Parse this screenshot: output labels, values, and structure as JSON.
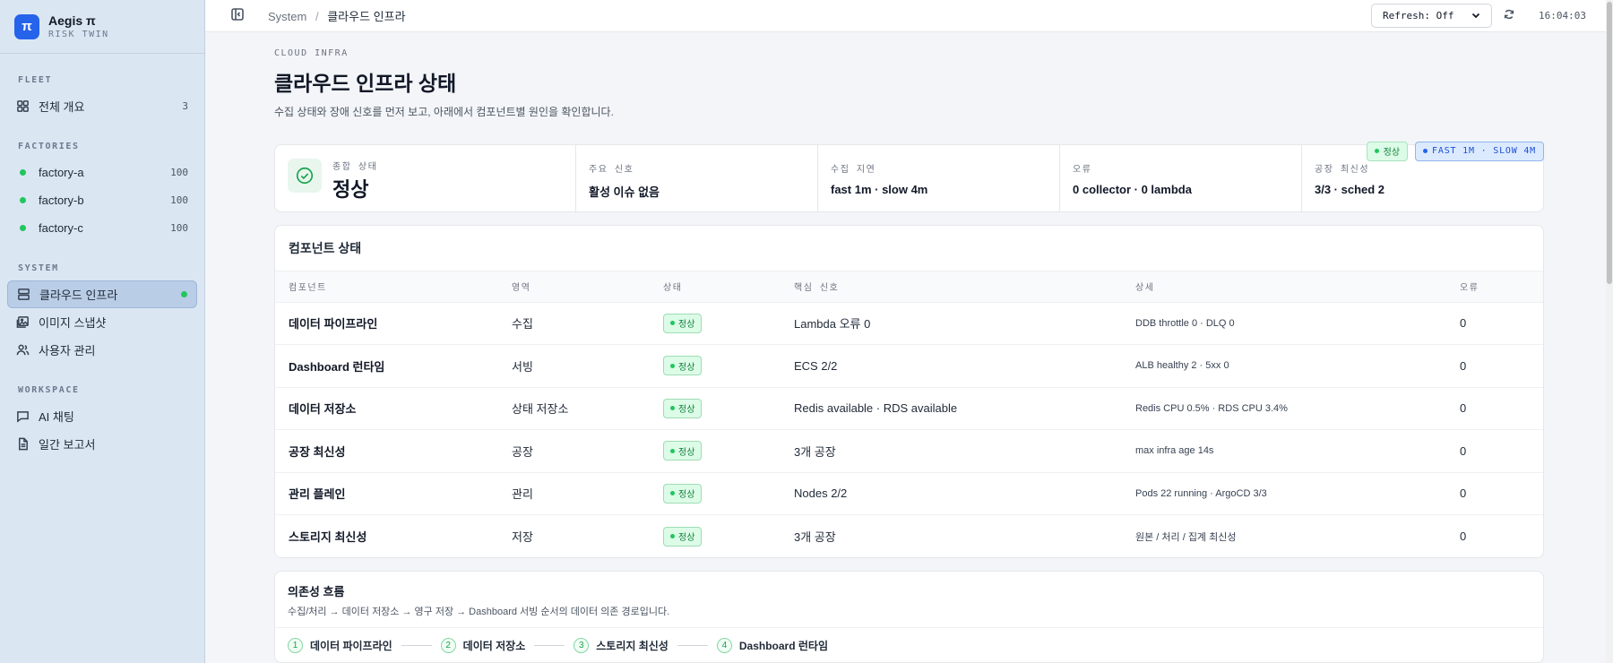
{
  "brand": {
    "logo": "π",
    "name": "Aegis π",
    "subtitle": "RISK TWIN"
  },
  "sidebar": {
    "sections": [
      {
        "heading": "FLEET",
        "items": [
          {
            "label": "전체 개요",
            "count": "3",
            "icon": "grid-icon"
          }
        ]
      },
      {
        "heading": "FACTORIES",
        "items": [
          {
            "label": "factory-a",
            "count": "100",
            "icon": "status-dot"
          },
          {
            "label": "factory-b",
            "count": "100",
            "icon": "status-dot"
          },
          {
            "label": "factory-c",
            "count": "100",
            "icon": "status-dot"
          }
        ]
      },
      {
        "heading": "SYSTEM",
        "items": [
          {
            "label": "클라우드 인프라",
            "icon": "server-icon",
            "active": true
          },
          {
            "label": "이미지 스냅샷",
            "icon": "image-icon"
          },
          {
            "label": "사용자 관리",
            "icon": "users-icon"
          }
        ]
      },
      {
        "heading": "WORKSPACE",
        "items": [
          {
            "label": "AI 채팅",
            "icon": "chat-icon"
          },
          {
            "label": "일간 보고서",
            "icon": "document-icon"
          }
        ]
      }
    ]
  },
  "topbar": {
    "breadcrumb_root": "System",
    "breadcrumb_sep": "/",
    "breadcrumb_current": "클라우드 인프라",
    "refresh_value": "Refresh: Off",
    "clock": "16:04:03"
  },
  "page": {
    "eyebrow": "CLOUD INFRA",
    "title": "클라우드 인프라 상태",
    "subtitle": "수집 상태와 장애 신호를 먼저 보고, 아래에서 컴포넌트별 원인을 확인합니다.",
    "badge_status": "정상",
    "badge_interval": "FAST 1M · SLOW 4M"
  },
  "summary": {
    "overall_label": "종합 상태",
    "overall_value": "정상",
    "cells": [
      {
        "label": "주요 신호",
        "value": "활성 이슈 없음"
      },
      {
        "label": "수집 지연",
        "value": "fast 1m · slow 4m"
      },
      {
        "label": "오류",
        "value": "0 collector · 0 lambda"
      },
      {
        "label": "공장 최신성",
        "value": "3/3 · sched 2"
      }
    ]
  },
  "components": {
    "title": "컴포넌트 상태",
    "headers": [
      "컴포넌트",
      "영역",
      "상태",
      "핵심 신호",
      "상세",
      "오류"
    ],
    "rows": [
      {
        "name": "데이터 파이프라인",
        "area": "수집",
        "status": "정상",
        "signal": "Lambda 오류 0",
        "detail": "DDB throttle 0 · DLQ 0",
        "errors": "0"
      },
      {
        "name": "Dashboard 런타임",
        "area": "서빙",
        "status": "정상",
        "signal": "ECS 2/2",
        "detail": "ALB healthy 2 · 5xx 0",
        "errors": "0"
      },
      {
        "name": "데이터 저장소",
        "area": "상태 저장소",
        "status": "정상",
        "signal": "Redis available · RDS available",
        "detail": "Redis CPU 0.5% · RDS CPU 3.4%",
        "errors": "0"
      },
      {
        "name": "공장 최신성",
        "area": "공장",
        "status": "정상",
        "signal": "3개 공장",
        "detail": "max infra age 14s",
        "errors": "0"
      },
      {
        "name": "관리 플레인",
        "area": "관리",
        "status": "정상",
        "signal": "Nodes 2/2",
        "detail": "Pods 22 running · ArgoCD 3/3",
        "errors": "0"
      },
      {
        "name": "스토리지 최신성",
        "area": "저장",
        "status": "정상",
        "signal": "3개 공장",
        "detail": "원본 / 처리 / 집계 최신성",
        "errors": "0"
      }
    ]
  },
  "flow": {
    "title": "의존성 흐름",
    "description": "수집/처리 → 데이터 저장소 → 영구 저장 → Dashboard 서빙 순서의 데이터 의존 경로입니다.",
    "steps": [
      {
        "num": "1",
        "label": "데이터 파이프라인"
      },
      {
        "num": "2",
        "label": "데이터 저장소"
      },
      {
        "num": "3",
        "label": "스토리지 최신성"
      },
      {
        "num": "4",
        "label": "Dashboard 런타임"
      }
    ]
  }
}
